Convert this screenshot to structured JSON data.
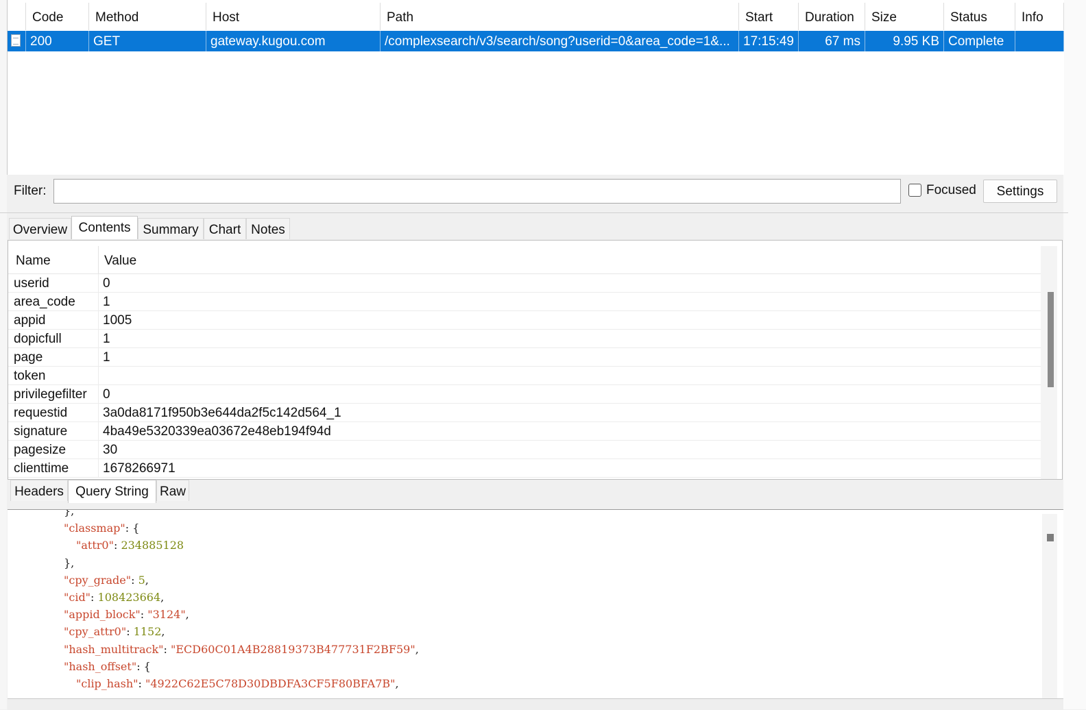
{
  "request_table": {
    "columns": [
      "Code",
      "Method",
      "Host",
      "Path",
      "Start",
      "Duration",
      "Size",
      "Status",
      "Info"
    ],
    "rows": [
      {
        "code": "200",
        "method": "GET",
        "host": "gateway.kugou.com",
        "path": "/complexsearch/v3/search/song?userid=0&area_code=1&...",
        "start": "17:15:49",
        "duration": "67 ms",
        "size": "9.95 KB",
        "status": "Complete",
        "info": ""
      }
    ]
  },
  "filter": {
    "label": "Filter:",
    "value": "",
    "focused_label": "Focused",
    "focused_checked": false,
    "settings_label": "Settings"
  },
  "main_tabs": [
    "Overview",
    "Contents",
    "Summary",
    "Chart",
    "Notes"
  ],
  "main_tabs_active": "Contents",
  "query_grid": {
    "headers": [
      "Name",
      "Value"
    ],
    "rows": [
      {
        "name": "userid",
        "value": "0"
      },
      {
        "name": "area_code",
        "value": "1"
      },
      {
        "name": "appid",
        "value": "1005"
      },
      {
        "name": "dopicfull",
        "value": "1"
      },
      {
        "name": "page",
        "value": "1"
      },
      {
        "name": "token",
        "value": ""
      },
      {
        "name": "privilegefilter",
        "value": "0"
      },
      {
        "name": "requestid",
        "value": "3a0da8171f950b3e644da2f5c142d564_1"
      },
      {
        "name": "signature",
        "value": "4ba49e5320339ea03672e48eb194f94d"
      },
      {
        "name": "pagesize",
        "value": "30"
      },
      {
        "name": "clienttime",
        "value": "1678266971"
      }
    ]
  },
  "sub_tabs": [
    "Headers",
    "Query String",
    "Raw"
  ],
  "sub_tabs_active": "Query String",
  "json_view": {
    "lines": [
      {
        "indent": 0,
        "prefix": "},",
        "key": "",
        "sep": "",
        "value": "",
        "vtype": "",
        "suffix": ""
      },
      {
        "indent": 0,
        "prefix": "",
        "key": "\"classmap\"",
        "sep": ": {",
        "value": "",
        "vtype": "",
        "suffix": ""
      },
      {
        "indent": 1,
        "prefix": "",
        "key": "\"attr0\"",
        "sep": ": ",
        "value": "234885128",
        "vtype": "num",
        "suffix": ""
      },
      {
        "indent": 0,
        "prefix": "},",
        "key": "",
        "sep": "",
        "value": "",
        "vtype": "",
        "suffix": ""
      },
      {
        "indent": 0,
        "prefix": "",
        "key": "\"cpy_grade\"",
        "sep": ": ",
        "value": "5",
        "vtype": "num",
        "suffix": ","
      },
      {
        "indent": 0,
        "prefix": "",
        "key": "\"cid\"",
        "sep": ": ",
        "value": "108423664",
        "vtype": "num",
        "suffix": ","
      },
      {
        "indent": 0,
        "prefix": "",
        "key": "\"appid_block\"",
        "sep": ": ",
        "value": "\"3124\"",
        "vtype": "str",
        "suffix": ","
      },
      {
        "indent": 0,
        "prefix": "",
        "key": "\"cpy_attr0\"",
        "sep": ": ",
        "value": "1152",
        "vtype": "num",
        "suffix": ","
      },
      {
        "indent": 0,
        "prefix": "",
        "key": "\"hash_multitrack\"",
        "sep": ": ",
        "value": "\"ECD60C01A4B28819373B477731F2BF59\"",
        "vtype": "str",
        "suffix": ","
      },
      {
        "indent": 0,
        "prefix": "",
        "key": "\"hash_offset\"",
        "sep": ": {",
        "value": "",
        "vtype": "",
        "suffix": ""
      },
      {
        "indent": 1,
        "prefix": "",
        "key": "\"clip_hash\"",
        "sep": ": ",
        "value": "\"4922C62E5C78D30DBDFA3CF5F80BFA7B\"",
        "vtype": "str",
        "suffix": ","
      }
    ]
  },
  "colors": {
    "selection": "#0a78d7",
    "json_key": "#c8472d",
    "json_number": "#7e8a13"
  }
}
